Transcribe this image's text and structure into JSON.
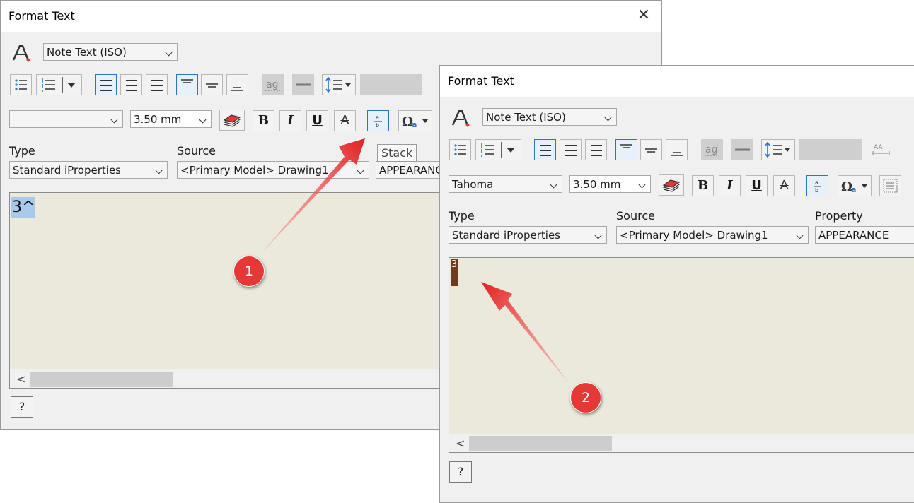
{
  "dialog1": {
    "title": "Format Text",
    "style_select": "Note Text (ISO)",
    "font_select": "",
    "size_select": "3.50 mm",
    "type_label": "Type",
    "type_value": "Standard iProperties",
    "source_label": "Source",
    "source_value": "<Primary Model> Drawing1",
    "property_value": "APPEARANC",
    "editor_text": "3^",
    "tooltip": "Stack"
  },
  "dialog2": {
    "title": "Format Text",
    "style_select": "Note Text (ISO)",
    "font_select": "Tahoma",
    "size_select": "3.50 mm",
    "type_label": "Type",
    "type_value": "Standard iProperties",
    "source_label": "Source",
    "source_value": "<Primary Model> Drawing1",
    "property_label": "Property",
    "property_value": "APPEARANCE",
    "editor_text": "3"
  },
  "buttons": {
    "bold": "B",
    "italic": "I",
    "underline": "U",
    "strike": "A",
    "help": "?"
  },
  "callouts": [
    "1",
    "2"
  ],
  "colors": {
    "arrow_red": "#e02020",
    "editor_bg": "#ebe9dc",
    "selection_blue": "#a8c8ec",
    "selection_brown": "#6b3a1f",
    "accent_blue": "#2b73c8"
  }
}
